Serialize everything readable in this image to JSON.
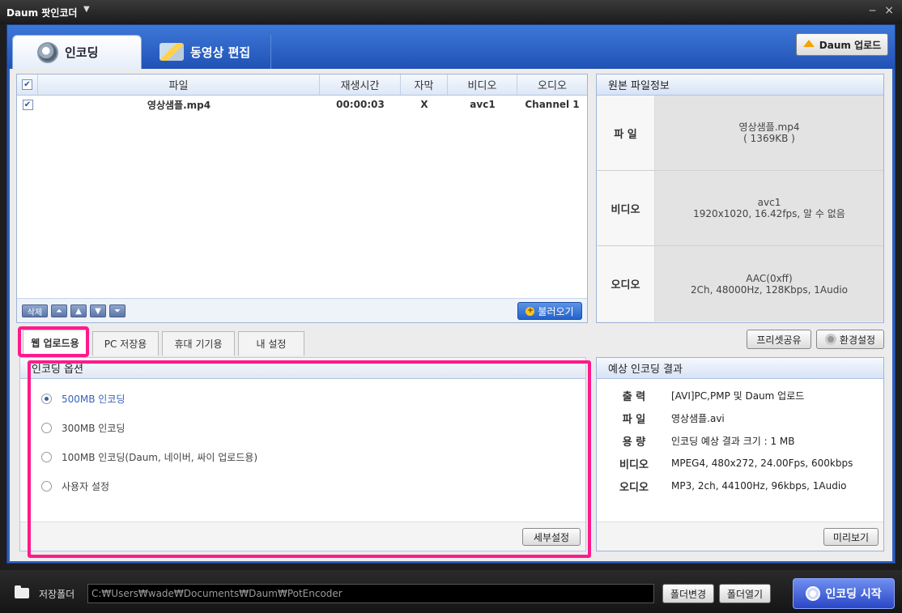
{
  "titlebar": {
    "title": "Daum 팟인코더",
    "dropdown": "▼",
    "minimize": "‒",
    "close": "×"
  },
  "tabs": {
    "encoding": "인코딩",
    "edit": "동영상 편집"
  },
  "daum_upload": "Daum 업로드",
  "file_list": {
    "headers": {
      "check": "✔",
      "file": "파일",
      "time": "재생시간",
      "subtitle": "자막",
      "video": "비디오",
      "audio": "오디오"
    },
    "rows": [
      {
        "checked": "✔",
        "file": "영상샘플.mp4",
        "time": "00:00:03",
        "subtitle": "X",
        "video": "avc1",
        "audio": "Channel 1"
      }
    ],
    "buttons": {
      "delete": "삭제",
      "top": "⏶",
      "up": "▲",
      "down": "▼",
      "bottom": "⏷",
      "load": "불러오기"
    }
  },
  "source_info": {
    "title": "원본 파일정보",
    "file_label": "파 일",
    "file_name": "영상샘플.mp4",
    "file_size": "( 1369KB )",
    "video_label": "비디오",
    "video_codec": "avc1",
    "video_detail": "1920x1020, 16.42fps, 알 수 없음",
    "audio_label": "오디오",
    "audio_codec": "AAC(0xff)",
    "audio_detail": "2Ch, 48000Hz, 128Kbps, 1Audio"
  },
  "preset_tabs": [
    "웹 업로드용",
    "PC 저장용",
    "휴대 기기용",
    "내 설정"
  ],
  "preset_share": "프리셋공유",
  "settings": "환경설정",
  "encoding_options": {
    "title": "인코딩 옵션",
    "options": [
      "500MB 인코딩",
      "300MB 인코딩",
      "100MB 인코딩(Daum, 네이버, 싸이 업로드용)",
      "사용자 설정"
    ],
    "selected_index": 0,
    "detail_button": "세부설정"
  },
  "expected_result": {
    "title": "예상 인코딩 결과",
    "rows": [
      {
        "label": "출 력",
        "value": "[AVI]PC,PMP 및 Daum 업로드"
      },
      {
        "label": "파 일",
        "value": "영상샘플.avi"
      },
      {
        "label": "용 량",
        "value": "인코딩 예상 결과 크기 : 1 MB"
      },
      {
        "label": "비디오",
        "value": "MPEG4, 480x272, 24.00Fps, 600kbps"
      },
      {
        "label": "오디오",
        "value": "MP3, 2ch, 44100Hz, 96kbps, 1Audio"
      }
    ],
    "preview_button": "미리보기"
  },
  "bottom": {
    "save_folder_label": "저장폴더",
    "path": "C:₩Users₩wade₩Documents₩Daum₩PotEncoder",
    "change_folder": "폴더변경",
    "open_folder": "폴더열기",
    "start": "인코딩 시작"
  },
  "colors": {
    "highlight": "#ff1a8c",
    "accent": "#2c5fc0",
    "selected_option": "#3a62b8"
  }
}
